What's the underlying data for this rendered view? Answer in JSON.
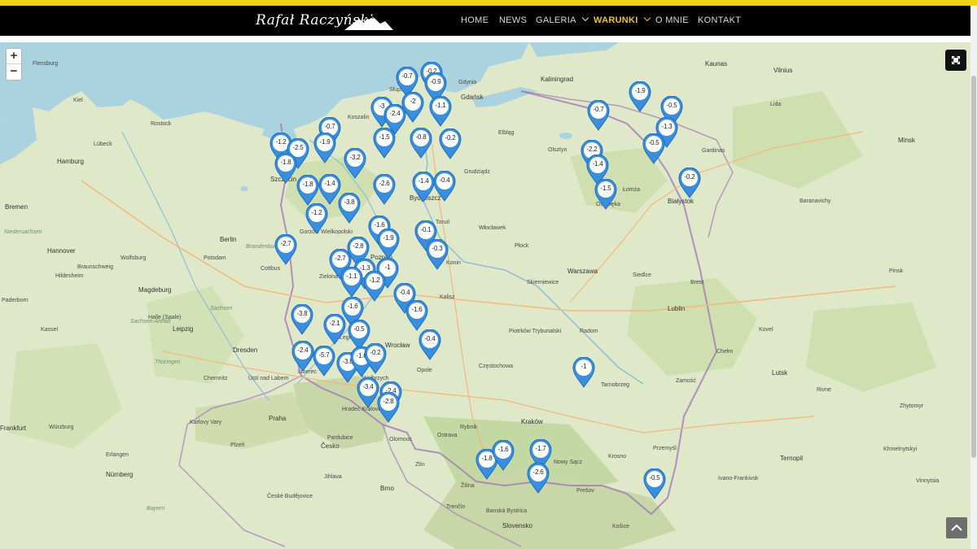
{
  "header": {
    "logo_text": "Rafał Raczyński",
    "nav": [
      {
        "label": "HOME",
        "active": false,
        "dropdown": false
      },
      {
        "label": "NEWS",
        "active": false,
        "dropdown": false
      },
      {
        "label": "GALERIA",
        "active": false,
        "dropdown": true
      },
      {
        "label": "WARUNKI",
        "active": true,
        "dropdown": true
      },
      {
        "label": "O MNIE",
        "active": false,
        "dropdown": false
      },
      {
        "label": "KONTAKT",
        "active": false,
        "dropdown": false
      }
    ]
  },
  "map": {
    "zoom_in": "+",
    "zoom_out": "−",
    "colors": {
      "water": "#aad3df",
      "land": "#dfe8c9",
      "marker_fill": "#3a8ee0",
      "marker_inner": "#ffffff",
      "accent": "#f0c419"
    },
    "places": [
      "Flensburg",
      "Kiel",
      "Rostock",
      "Lübeck",
      "Hamburg",
      "Bremen",
      "Hannover",
      "Braunschweig",
      "Wolfsburg",
      "Hildesheim",
      "Berlin",
      "Potsdam",
      "Magdeburg",
      "Halle (Saale)",
      "Leipzig",
      "Dresden",
      "Chemnitz",
      "Kassel",
      "Paderborn",
      "Cottbus",
      "Frankfurt",
      "Praha",
      "Pardubice",
      "Jihlava",
      "Brno",
      "Plzeň",
      "České Budějovice",
      "Nürnberg",
      "Erlangen",
      "Würzburg",
      "Szczecin",
      "Gorzów Wielkopolski",
      "Zielona Góra",
      "Poznań",
      "Konin",
      "Bydgoszcz",
      "Toruń",
      "Grudziądz",
      "Koszalin",
      "Słupsk",
      "Gdynia",
      "Gdańsk",
      "Elbląg",
      "Olsztyn",
      "Kaliningrad",
      "Łomża",
      "Białystok",
      "Ostrołęka",
      "Włocławek",
      "Płock",
      "Warszawa",
      "Siedlce",
      "Skierniewice",
      "Radom",
      "Lublin",
      "Chełm",
      "Zamość",
      "Kalisz",
      "Wrocław",
      "Legnica",
      "Wałbrzych",
      "Opole",
      "Częstochowa",
      "Piotrków Trybunalski",
      "Tarnobrzeg",
      "Kraków",
      "Rybnik",
      "Nowy Sącz",
      "Krosno",
      "Przemyśl",
      "Žilina",
      "Trenčín",
      "Banská Bystrica",
      "Prešov",
      "Košice",
      "Slovensko",
      "Kaunas",
      "Vilnius",
      "Gardinas",
      "Brest",
      "Lutsk",
      "Rivne",
      "Zhytomyr",
      "Ternopil",
      "Ivano-Frankivsk",
      "Khmelnytskyi",
      "Vinnytsia",
      "Minsk",
      "Baranavichy",
      "Lida",
      "Pinsk",
      "Kovel",
      "Niedersachsen",
      "Brandenburg",
      "Sachsen",
      "Sachsen-Anhalt",
      "Thüringen",
      "Bayern",
      "Česko",
      "Karlovy Vary",
      "Ústí nad Labem",
      "Liberec",
      "Hradec Králové",
      "Olomouc",
      "Ostrava",
      "Zlín"
    ],
    "markers": [
      {
        "label": "-0.7"
      },
      {
        "label": "-0.2"
      },
      {
        "label": "-0.9"
      },
      {
        "label": "-3"
      },
      {
        "label": "-2"
      },
      {
        "label": "-1.1"
      },
      {
        "label": "-2.4"
      },
      {
        "label": "-1.5"
      },
      {
        "label": "-0.8"
      },
      {
        "label": "-0.2"
      },
      {
        "label": "-0.7"
      },
      {
        "label": "-1.2"
      },
      {
        "label": "-2.5"
      },
      {
        "label": "-1.9"
      },
      {
        "label": "-1.8"
      },
      {
        "label": "-3.2"
      },
      {
        "label": "-1.8"
      },
      {
        "label": "-1.4"
      },
      {
        "label": "-3.8"
      },
      {
        "label": "-2.6"
      },
      {
        "label": "-1.4"
      },
      {
        "label": "-0.4"
      },
      {
        "label": "-1.2"
      },
      {
        "label": "-2.7"
      },
      {
        "label": "-1.6"
      },
      {
        "label": "-1.9"
      },
      {
        "label": "-0.1"
      },
      {
        "label": "-2.8"
      },
      {
        "label": "-2.7"
      },
      {
        "label": "-1.3"
      },
      {
        "label": "-1"
      },
      {
        "label": "-0.3"
      },
      {
        "label": "-1.1"
      },
      {
        "label": "-1.2"
      },
      {
        "label": "-0.4"
      },
      {
        "label": "-1.6"
      },
      {
        "label": "-1.6"
      },
      {
        "label": "-3.8"
      },
      {
        "label": "-2.1"
      },
      {
        "label": "-0.5"
      },
      {
        "label": "-0.4"
      },
      {
        "label": "-2.4"
      },
      {
        "label": "-5.7"
      },
      {
        "label": "-3.8"
      },
      {
        "label": "-1.6"
      },
      {
        "label": "-0.2"
      },
      {
        "label": "-3.4"
      },
      {
        "label": "-2.4"
      },
      {
        "label": "-2.8"
      },
      {
        "label": "-1"
      },
      {
        "label": "-1.8"
      },
      {
        "label": "-1.6"
      },
      {
        "label": "-1.7"
      },
      {
        "label": "-2.6"
      },
      {
        "label": "-0.5"
      },
      {
        "label": "-0.7"
      },
      {
        "label": "-1.9"
      },
      {
        "label": "-0.5"
      },
      {
        "label": "-1.3"
      },
      {
        "label": "-0.5"
      },
      {
        "label": "-2.2"
      },
      {
        "label": "-1.4"
      },
      {
        "label": "-1.5"
      },
      {
        "label": "-0.2"
      }
    ]
  }
}
